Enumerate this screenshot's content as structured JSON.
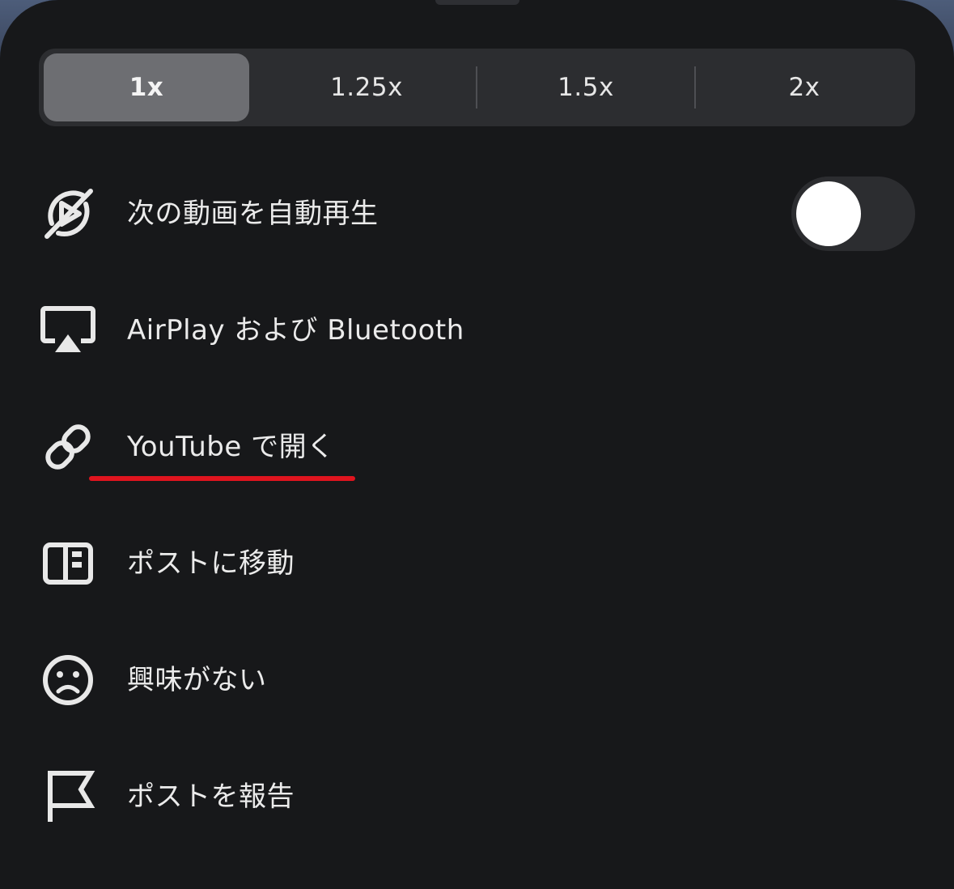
{
  "speed": {
    "options": [
      "1x",
      "1.25x",
      "1.5x",
      "2x"
    ],
    "selected": "1x"
  },
  "menu": {
    "autoplay": {
      "label": "次の動画を自動再生",
      "icon": "autoplay-off-icon",
      "enabled": false
    },
    "airplay": {
      "label": "AirPlay および Bluetooth",
      "icon": "airplay-icon"
    },
    "open_youtube": {
      "label": "YouTube で開く",
      "icon": "link-icon"
    },
    "go_to_post": {
      "label": "ポストに移動",
      "icon": "post-panel-icon"
    },
    "not_interested": {
      "label": "興味がない",
      "icon": "sad-face-icon"
    },
    "report_post": {
      "label": "ポストを報告",
      "icon": "flag-icon"
    }
  },
  "colors": {
    "sheet_background": "#17181a",
    "segment_background": "#2c2d30",
    "selected_segment": "#6d6e72",
    "text": "#ebebeb",
    "annotation_underline": "#e0141e"
  }
}
